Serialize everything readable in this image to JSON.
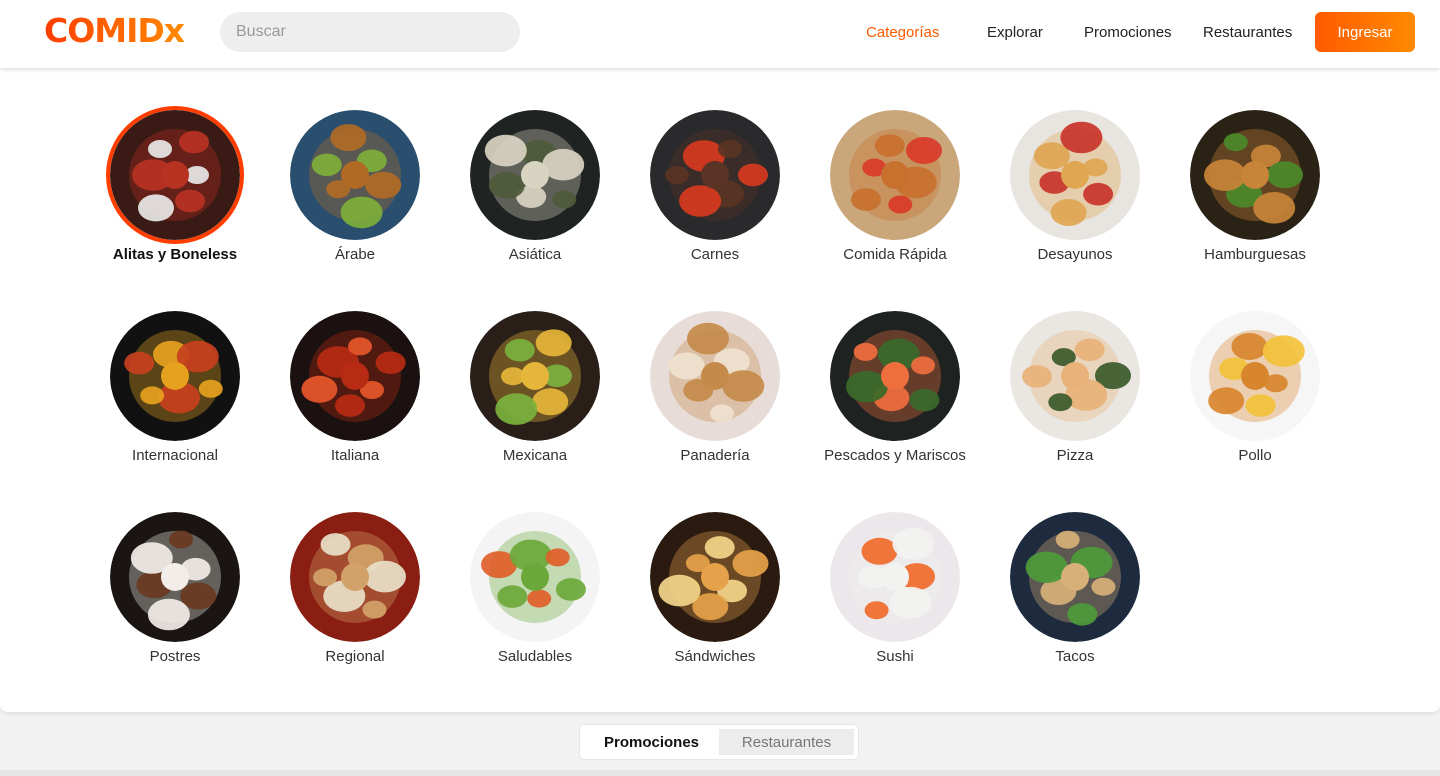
{
  "header": {
    "logo_text": "COMIDx",
    "search_placeholder": "Buscar",
    "nav": [
      {
        "label": "Categorías",
        "active": true
      },
      {
        "label": "Explorar",
        "active": false
      },
      {
        "label": "Promociones",
        "active": false
      },
      {
        "label": "Restaurantes",
        "active": false
      }
    ],
    "login_label": "Ingresar"
  },
  "categories": [
    {
      "label": "Alitas y Boneless",
      "selected": true,
      "bg": "#3a1a14",
      "fg": "#b83222",
      "accent": "#e8e8e8"
    },
    {
      "label": "Árabe",
      "selected": false,
      "bg": "#2a4f6e",
      "fg": "#b06a25",
      "accent": "#7fae3a"
    },
    {
      "label": "Asiática",
      "selected": false,
      "bg": "#1f2322",
      "fg": "#d9d4c2",
      "accent": "#4f5a3a"
    },
    {
      "label": "Carnes",
      "selected": false,
      "bg": "#2a2a2c",
      "fg": "#5a3424",
      "accent": "#d63a1e"
    },
    {
      "label": "Comida Rápida",
      "selected": false,
      "bg": "#c9a77a",
      "fg": "#c8702e",
      "accent": "#d83a2a"
    },
    {
      "label": "Desayunos",
      "selected": false,
      "bg": "#e8e4df",
      "fg": "#e0a652",
      "accent": "#c9342a"
    },
    {
      "label": "Hamburguesas",
      "selected": false,
      "bg": "#2b2216",
      "fg": "#c88438",
      "accent": "#4c8a2a"
    },
    {
      "label": "Internacional",
      "selected": false,
      "bg": "#111111",
      "fg": "#e6a21e",
      "accent": "#c7401e"
    },
    {
      "label": "Italiana",
      "selected": false,
      "bg": "#1a1110",
      "fg": "#b72a14",
      "accent": "#e8572a"
    },
    {
      "label": "Mexicana",
      "selected": false,
      "bg": "#2a1e18",
      "fg": "#e6b63a",
      "accent": "#7cb23e"
    },
    {
      "label": "Panadería",
      "selected": false,
      "bg": "#e8dcd8",
      "fg": "#c48a4a",
      "accent": "#f0e2cf"
    },
    {
      "label": "Pescados y Mariscos",
      "selected": false,
      "bg": "#1e2220",
      "fg": "#ef6e3e",
      "accent": "#3a6a2a"
    },
    {
      "label": "Pizza",
      "selected": false,
      "bg": "#eae6e2",
      "fg": "#e8b27a",
      "accent": "#3a5a2a"
    },
    {
      "label": "Pollo",
      "selected": false,
      "bg": "#f6f6f6",
      "fg": "#d8862e",
      "accent": "#f2c23a"
    },
    {
      "label": "Postres",
      "selected": false,
      "bg": "#1a1412",
      "fg": "#f2ede8",
      "accent": "#6a3a22"
    },
    {
      "label": "Regional",
      "selected": false,
      "bg": "#8a1e12",
      "fg": "#d2a26a",
      "accent": "#e8e0c8"
    },
    {
      "label": "Saludables",
      "selected": false,
      "bg": "#f4f4f4",
      "fg": "#6aa83a",
      "accent": "#e0602a"
    },
    {
      "label": "Sándwiches",
      "selected": false,
      "bg": "#2a1a10",
      "fg": "#e6a24a",
      "accent": "#f3d68a"
    },
    {
      "label": "Sushi",
      "selected": false,
      "bg": "#ebe7ea",
      "fg": "#f2f2f0",
      "accent": "#f06a2a"
    },
    {
      "label": "Tacos",
      "selected": false,
      "bg": "#1e2a3e",
      "fg": "#d6b078",
      "accent": "#4e9a3a"
    }
  ],
  "bottom_tabs": [
    {
      "label": "Promociones",
      "active": true
    },
    {
      "label": "Restaurantes",
      "active": false
    }
  ]
}
